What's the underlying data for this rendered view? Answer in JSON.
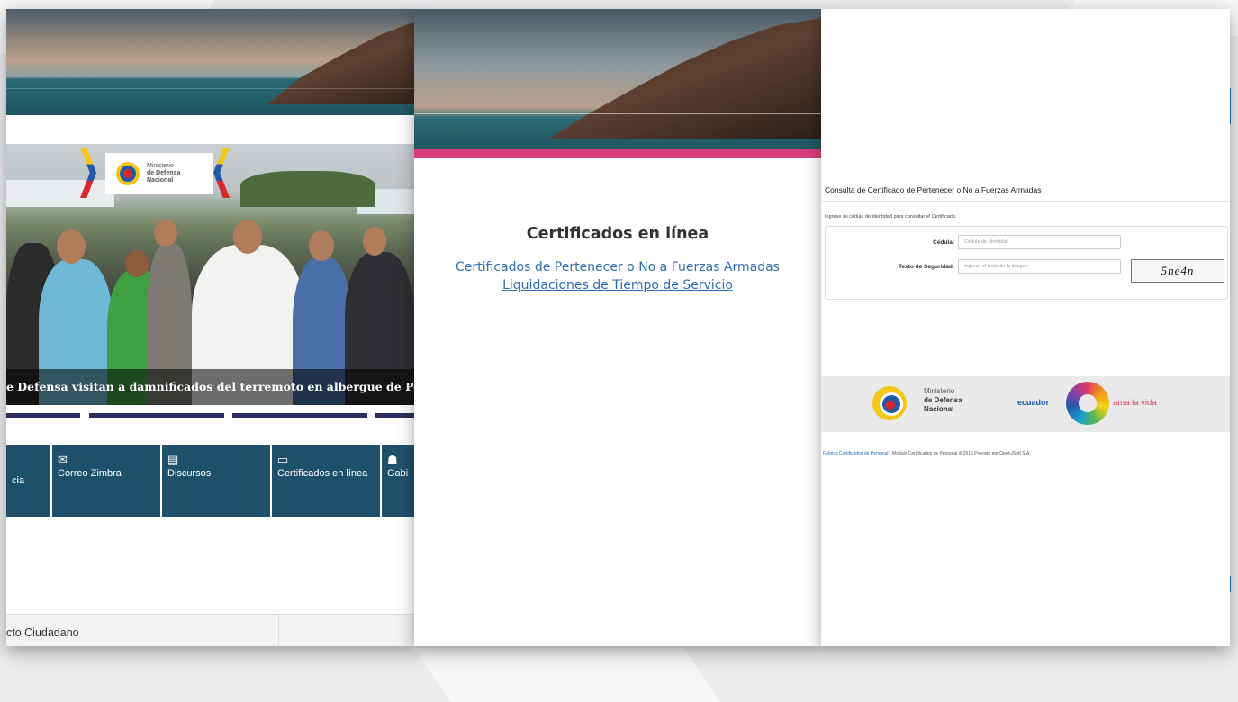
{
  "panel_home": {
    "photo_caption": "e Defensa visitan a damnificados del terremoto en albergue de Portoviejo",
    "banner_logo_lines": [
      "Ministerio",
      "de Defensa",
      "Nacional"
    ],
    "tiles": [
      {
        "label": "cia",
        "icon": "none"
      },
      {
        "label": "Correo Zimbra",
        "icon": "envelope-icon"
      },
      {
        "label": "Discursos",
        "icon": "speech-bubble-icon"
      },
      {
        "label": "Certificados en línea",
        "icon": "monitor-icon"
      },
      {
        "label": "Gabi",
        "icon": "people-icon"
      }
    ],
    "footer_label": "cto Ciudadano",
    "colors": {
      "tile_bg": "#1f506b",
      "dots": "#2b2d5e"
    }
  },
  "panel_certificados": {
    "title": "Certificados en línea",
    "link_fuerzas": "Certificados de Pertenecer o No a Fuerzas Armadas",
    "link_liquidaciones": "Liquidaciones de Tiempo de Servicio",
    "colors": {
      "accent_bar": "#d83e7a",
      "link": "#2f6db3"
    }
  },
  "panel_consulta": {
    "title": "Consulta de Certificado de Pertenecer o No a Fuerzas Armadas",
    "hint": "Ingrese su cédula de identidad para consultar el Certificado.",
    "cedula_label": "Cédula:",
    "cedula_placeholder": "Cédula de Identidad",
    "seguridad_label": "Texto de Seguridad:",
    "seguridad_placeholder": "Ingrese el texto de la imagen",
    "captcha_text": "5ne4n",
    "logo_lines": [
      "Ministerio",
      "de Defensa",
      "Nacional"
    ],
    "ecuador_label": "ecuador",
    "ama_label": "ama la vida",
    "footer_link": "Fábrica Certificados de Personal",
    "footer_text": " - Módulo Certificados de Personal @2015 Provisto por OpenJSoft S.A."
  }
}
